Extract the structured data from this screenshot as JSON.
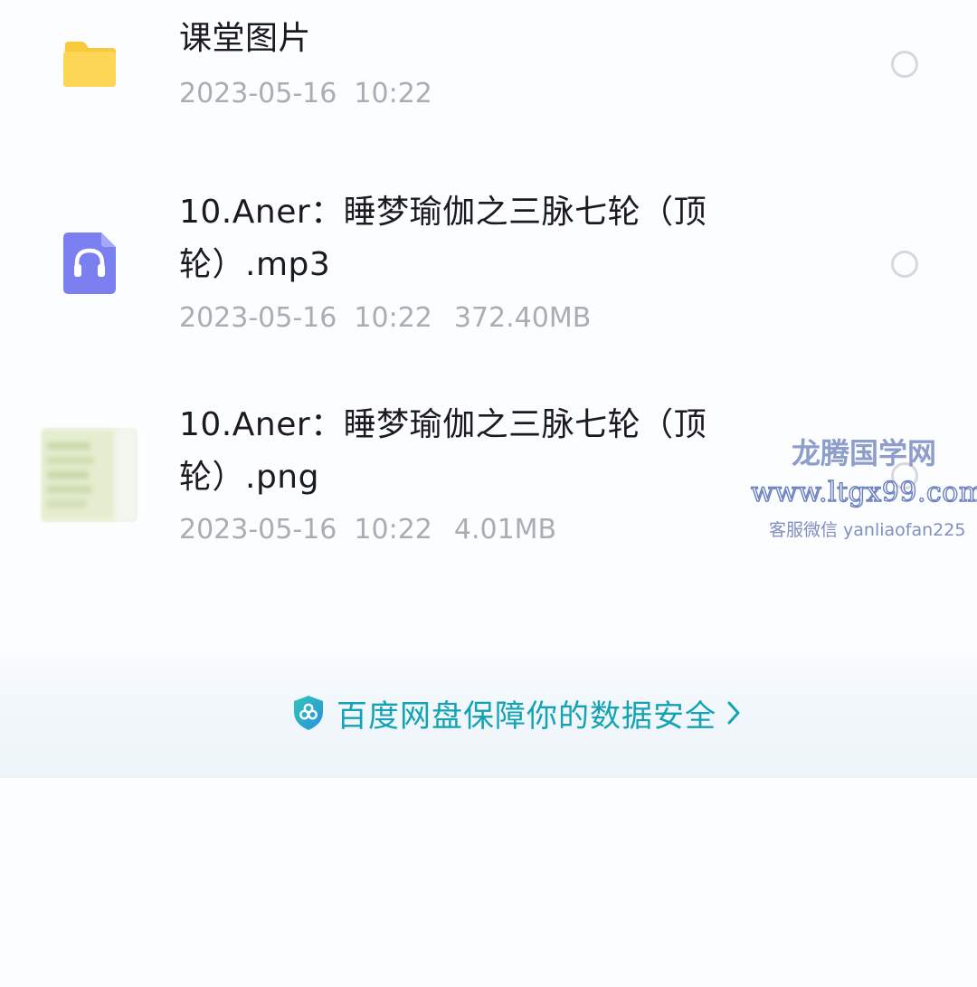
{
  "files": [
    {
      "name": "课堂图片",
      "date": "2023-05-16  10:22",
      "size": "",
      "icon": "folder-icon"
    },
    {
      "name": "10.Aner：睡梦瑜伽之三脉七轮（顶轮）.mp3",
      "date": "2023-05-16  10:22",
      "size": "372.40MB",
      "icon": "audio-file-icon"
    },
    {
      "name": "10.Aner：睡梦瑜伽之三脉七轮（顶轮）.png",
      "date": "2023-05-16  10:22",
      "size": "4.01MB",
      "icon": "image-thumbnail"
    }
  ],
  "watermark": {
    "title": "龙腾国学网",
    "url": "www.ltgx99.com",
    "contact": "客服微信 yanliaofan225"
  },
  "security_banner": {
    "text": "百度网盘保障你的数据安全",
    "icon": "shield-icon"
  },
  "colors": {
    "folder": "#fcd44f",
    "audio_icon": "#7b7ff0",
    "security_text": "#14a3b4",
    "meta_text": "#a9adb4"
  }
}
